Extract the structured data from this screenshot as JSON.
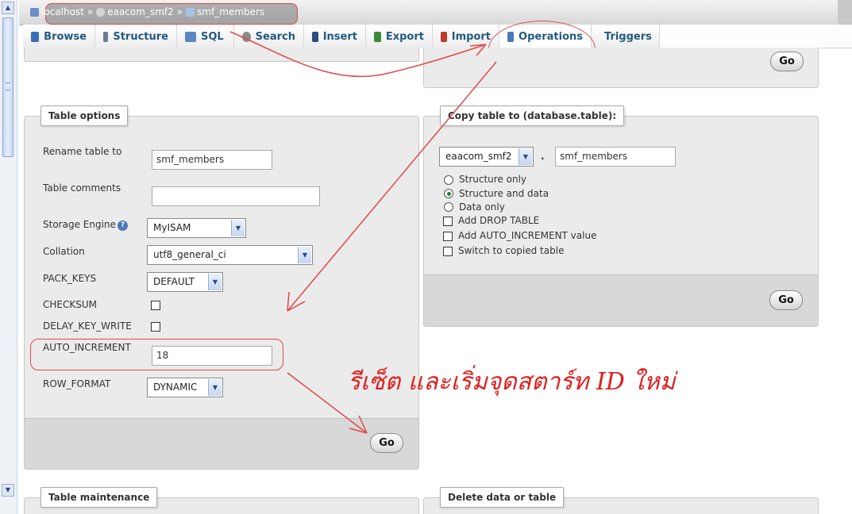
{
  "breadcrumb": [
    {
      "label": "localhost",
      "icon": "server-icon"
    },
    {
      "label": "eaacom_smf2",
      "icon": "database-icon"
    },
    {
      "label": "smf_members",
      "icon": "table-icon"
    }
  ],
  "breadcrumb_separator": "»",
  "tabs": [
    {
      "label": "Browse",
      "icon": "browse-icon",
      "color": "#3b6fb6"
    },
    {
      "label": "Structure",
      "icon": "structure-icon",
      "color": "#6b7c93"
    },
    {
      "label": "SQL",
      "icon": "sql-icon",
      "color": "#5b86c2"
    },
    {
      "label": "Search",
      "icon": "search-icon",
      "color": "#8c8c8c"
    },
    {
      "label": "Insert",
      "icon": "insert-icon",
      "color": "#2c4d7a"
    },
    {
      "label": "Export",
      "icon": "export-icon",
      "color": "#3a8a3a"
    },
    {
      "label": "Import",
      "icon": "import-icon",
      "color": "#c0392b"
    },
    {
      "label": "Operations",
      "icon": "wrench-icon",
      "color": "#4a79b7"
    },
    {
      "label": "Triggers",
      "icon": "triggers-icon",
      "color": "#777777"
    }
  ],
  "active_tab": "Operations",
  "top_panel": {
    "go_label": "Go"
  },
  "table_options": {
    "legend": "Table options",
    "rename_label": "Rename table to",
    "rename_value": "smf_members",
    "comments_label": "Table comments",
    "comments_value": "",
    "storage_label": "Storage Engine",
    "storage_value": "MyISAM",
    "collation_label": "Collation",
    "collation_value": "utf8_general_ci",
    "pack_keys_label": "PACK_KEYS",
    "pack_keys_value": "DEFAULT",
    "checksum_label": "CHECKSUM",
    "checksum_checked": false,
    "delay_key_write_label": "DELAY_KEY_WRITE",
    "delay_key_write_checked": false,
    "auto_increment_label": "AUTO_INCREMENT",
    "auto_increment_value": "18",
    "row_format_label": "ROW_FORMAT",
    "row_format_value": "DYNAMIC",
    "go_label": "Go"
  },
  "copy_table": {
    "legend": "Copy table to (database.table):",
    "db_value": "eaacom_smf2",
    "dot": ".",
    "table_value": "smf_members",
    "options": [
      {
        "label": "Structure only",
        "type": "radio",
        "checked": false
      },
      {
        "label": "Structure and data",
        "type": "radio",
        "checked": true
      },
      {
        "label": "Data only",
        "type": "radio",
        "checked": false
      },
      {
        "label": "Add DROP TABLE",
        "type": "checkbox",
        "checked": false
      },
      {
        "label": "Add AUTO_INCREMENT value",
        "type": "checkbox",
        "checked": false
      },
      {
        "label": "Switch to copied table",
        "type": "checkbox",
        "checked": false
      }
    ],
    "go_label": "Go"
  },
  "table_maintenance": {
    "legend": "Table maintenance"
  },
  "delete_data": {
    "legend": "Delete data or table"
  },
  "annotation_text": "รีเซ็ต และเริ่มจุดสตาร์ท ID ใหม่",
  "annotation_color": "#e01e1e"
}
